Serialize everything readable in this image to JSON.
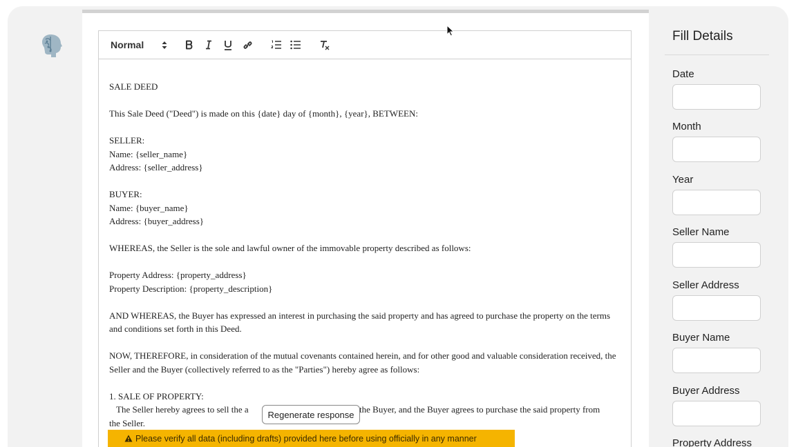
{
  "toolbar": {
    "format_select": "Normal",
    "icons": [
      "bold-icon",
      "italic-icon",
      "underline-icon",
      "link-icon",
      "ordered-list-icon",
      "bullet-list-icon",
      "clear-format-icon"
    ]
  },
  "document": {
    "title": "SALE DEED",
    "intro": "This Sale Deed (\"Deed\") is made on this {date} day of {month}, {year}, BETWEEN:",
    "seller_heading": "SELLER:",
    "seller_name": "Name: {seller_name}",
    "seller_address": "Address: {seller_address}",
    "buyer_heading": "BUYER:",
    "buyer_name": "Name: {buyer_name}",
    "buyer_address": "Address: {buyer_address}",
    "whereas": "WHEREAS, the Seller is the sole and lawful owner of the immovable property described as follows:",
    "property_address": "Property Address: {property_address}",
    "property_description": "Property Description: {property_description}",
    "and_whereas": "AND WHEREAS, the Buyer has expressed an interest in purchasing the said property and has agreed to purchase the property on the terms and conditions set forth in this Deed.",
    "now_therefore": "NOW, THEREFORE, in consideration of the mutual covenants contained herein, and for other good and valuable consideration received, the Seller and the Buyer (collectively referred to as the \"Parties\") hereby agree as follows:",
    "section1_heading": "1. SALE OF PROPERTY:",
    "section1_text_a": "The Seller hereby agrees to sell the a",
    "section1_text_b": "to the Buyer, and the Buyer agrees to purchase the said property from",
    "section1_text_c": "the Seller."
  },
  "regenerate_label": "Regenerate response",
  "warning_text": "Please verify all data (including drafts) provided here before using officially in any manner",
  "side_panel": {
    "title": "Fill Details",
    "fields": [
      {
        "label": "Date",
        "value": ""
      },
      {
        "label": "Month",
        "value": ""
      },
      {
        "label": "Year",
        "value": ""
      },
      {
        "label": "Seller Name",
        "value": ""
      },
      {
        "label": "Seller Address",
        "value": ""
      },
      {
        "label": "Buyer Name",
        "value": ""
      },
      {
        "label": "Buyer Address",
        "value": ""
      },
      {
        "label": "Property Address",
        "value": ""
      }
    ]
  },
  "colors": {
    "warning_bg": "#f5b400",
    "window_bg": "#f2f2f2"
  }
}
